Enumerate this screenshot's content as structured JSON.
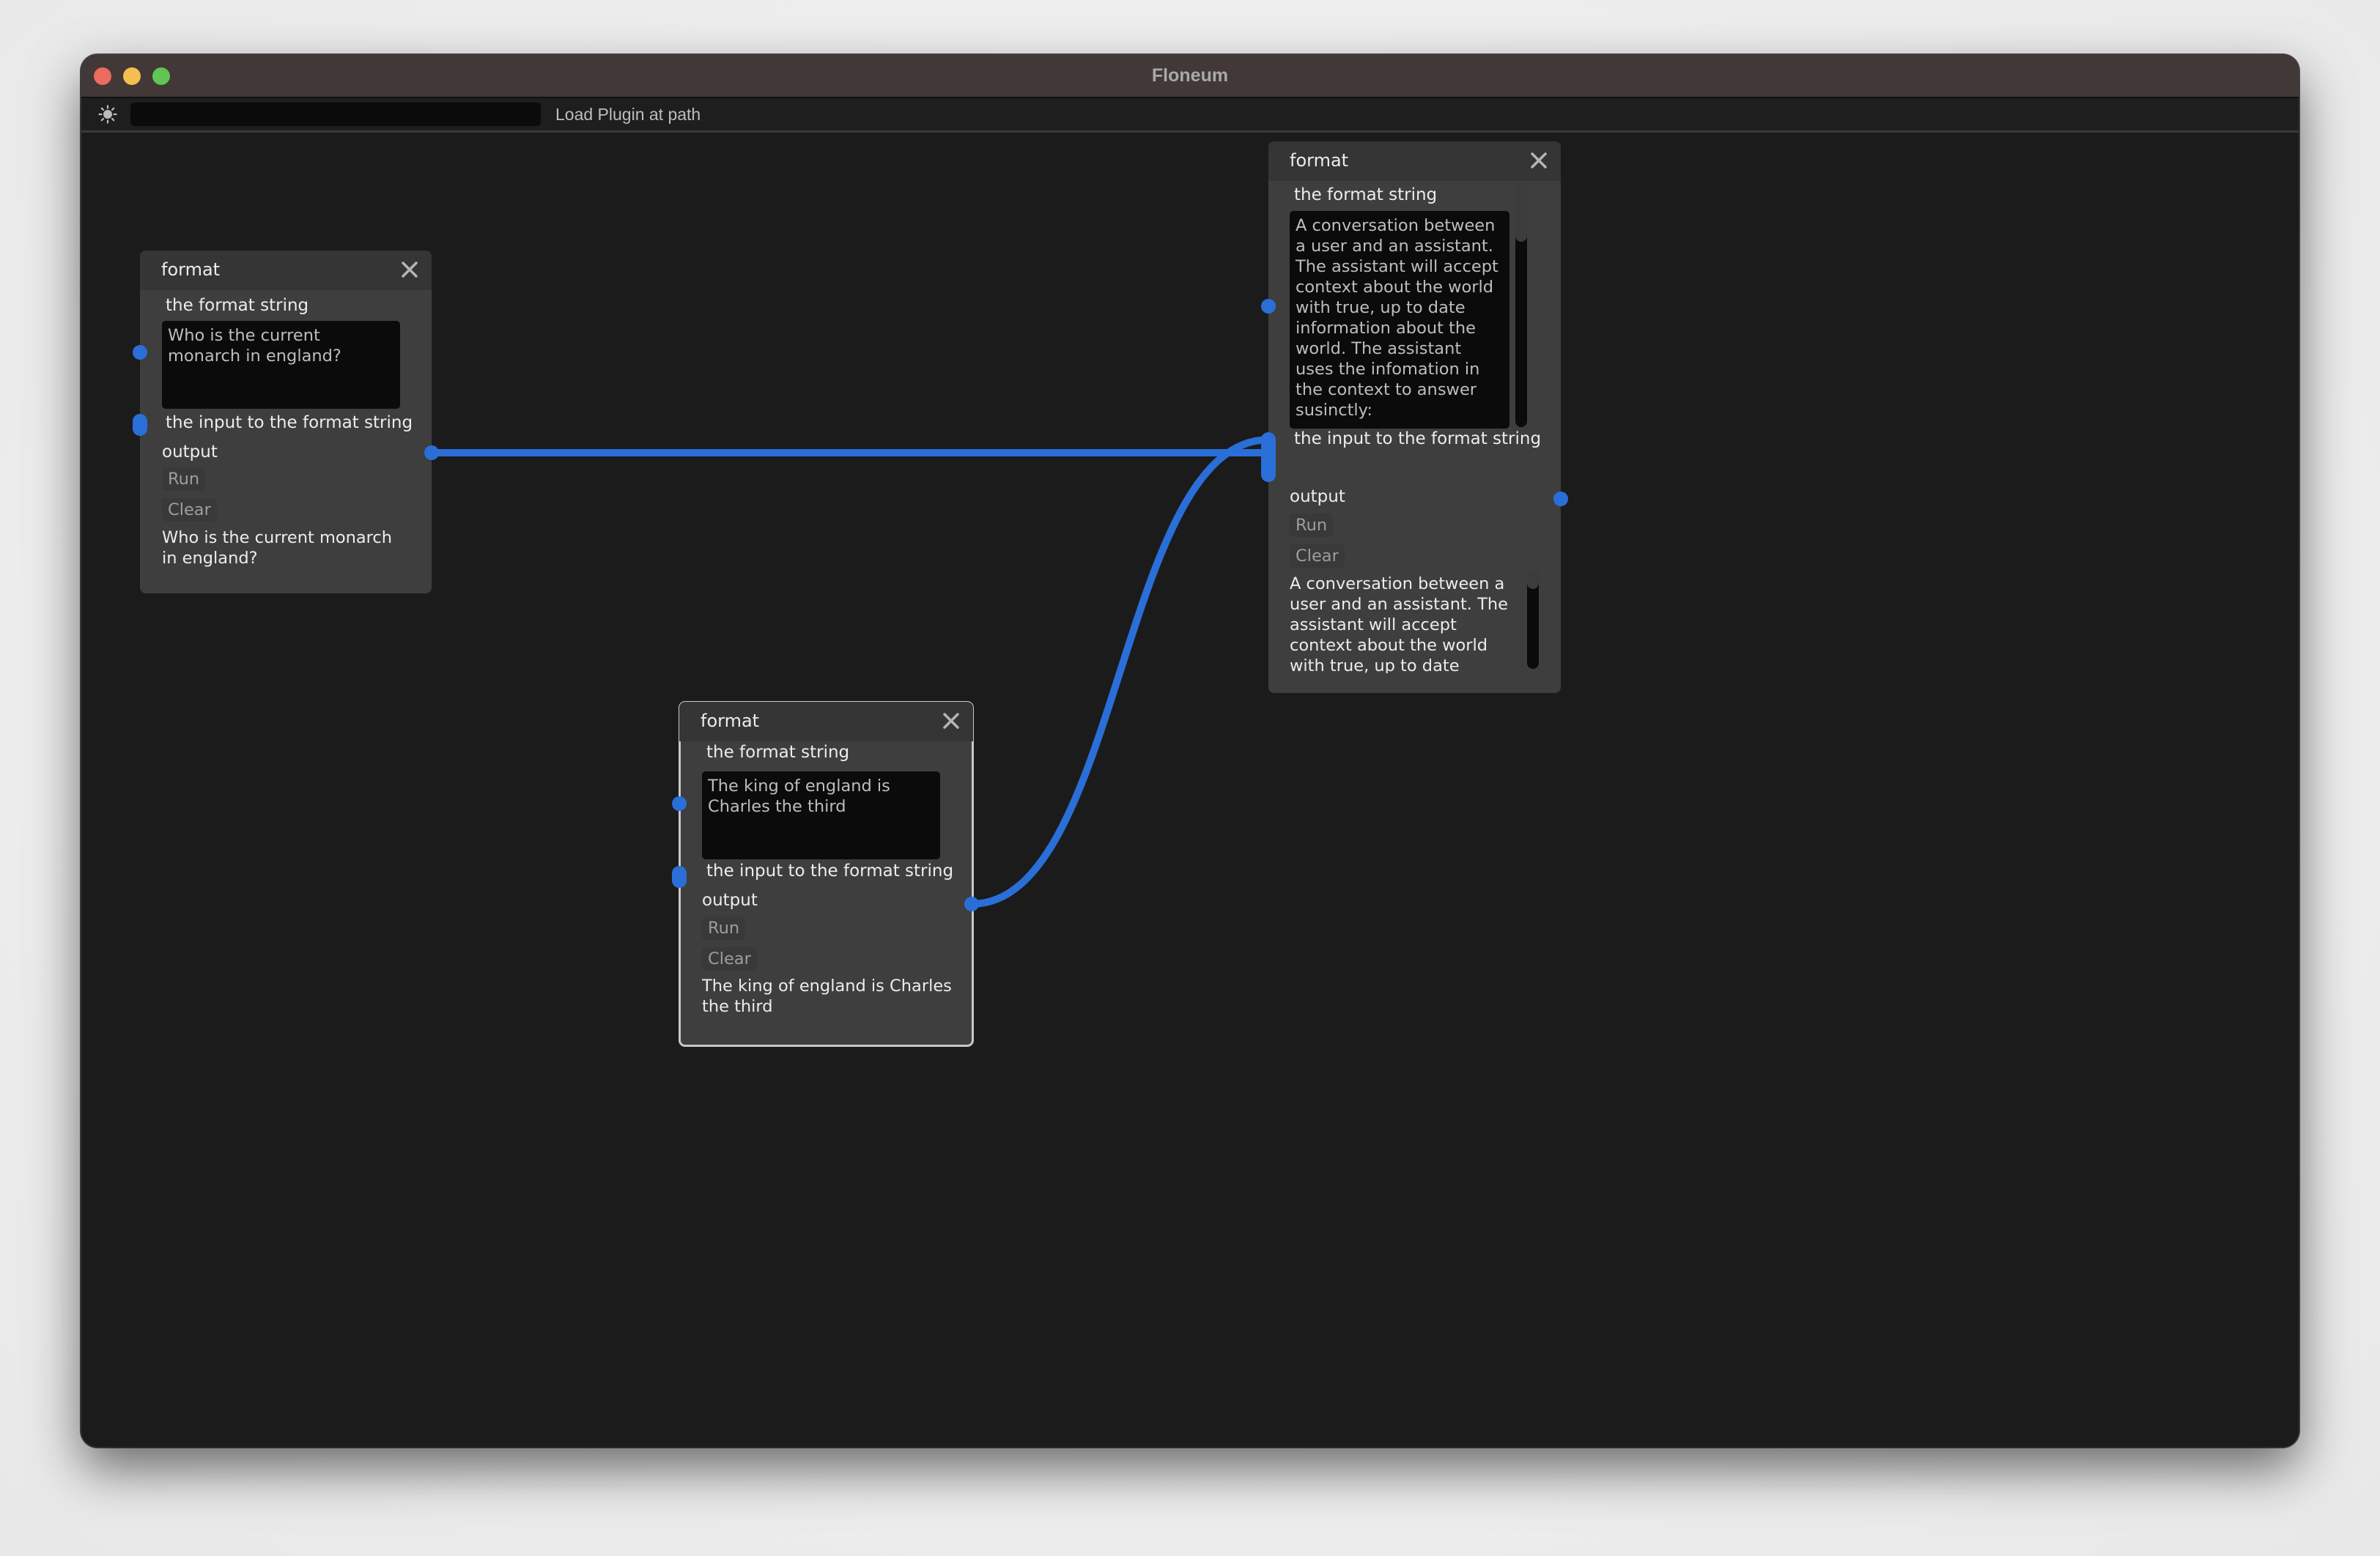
{
  "window": {
    "title": "Floneum",
    "buttons": [
      "close",
      "minimize",
      "maximize"
    ]
  },
  "toolbar": {
    "theme_icon": "sun-icon",
    "plugin_path_value": "",
    "plugin_path_placeholder": "",
    "load_plugin_label": "Load Plugin at path"
  },
  "colors": {
    "accent": "#2a6fd8",
    "canvas": "#1b1b1b",
    "node_body": "#3e3e3e",
    "node_header": "#353535",
    "titlebar": "#413837"
  },
  "nodes": [
    {
      "title": "format",
      "close_icon": "close-icon",
      "input_label": "the format string",
      "format_string": "Who is the current\nmonarch in england?",
      "input_to_label": "the input to the format string",
      "output_label": "output",
      "run_label": "Run",
      "clear_label": "Clear",
      "output_text": "Who is the current monarch\nin england?",
      "selected": false
    },
    {
      "title": "format",
      "close_icon": "close-icon",
      "input_label": "the format string",
      "format_string": "A conversation between\na user and an assistant.\nThe assistant will accept\ncontext about the world\nwith true, up to date\ninformation about the\nworld. The assistant\nuses the infomation in\nthe context to answer\nsusinctly:",
      "input_to_label": "the input to the format string",
      "output_label": "output",
      "run_label": "Run",
      "clear_label": "Clear",
      "output_text": "A conversation between a\nuser and an assistant. The\nassistant will accept\ncontext about the world\nwith true, up to date",
      "selected": false
    },
    {
      "title": "format",
      "close_icon": "close-icon",
      "input_label": "the format string",
      "format_string": "The king of england is\nCharles the third",
      "input_to_label": "the input to the format string",
      "output_label": "output",
      "run_label": "Run",
      "clear_label": "Clear",
      "output_text": "The king of england is Charles\nthe third",
      "selected": true
    }
  ],
  "connections": [
    {
      "from": "node-1.output",
      "to": "node-2.input-to-format-string"
    },
    {
      "from": "node-3.output",
      "to": "node-2.input-to-format-string"
    }
  ]
}
